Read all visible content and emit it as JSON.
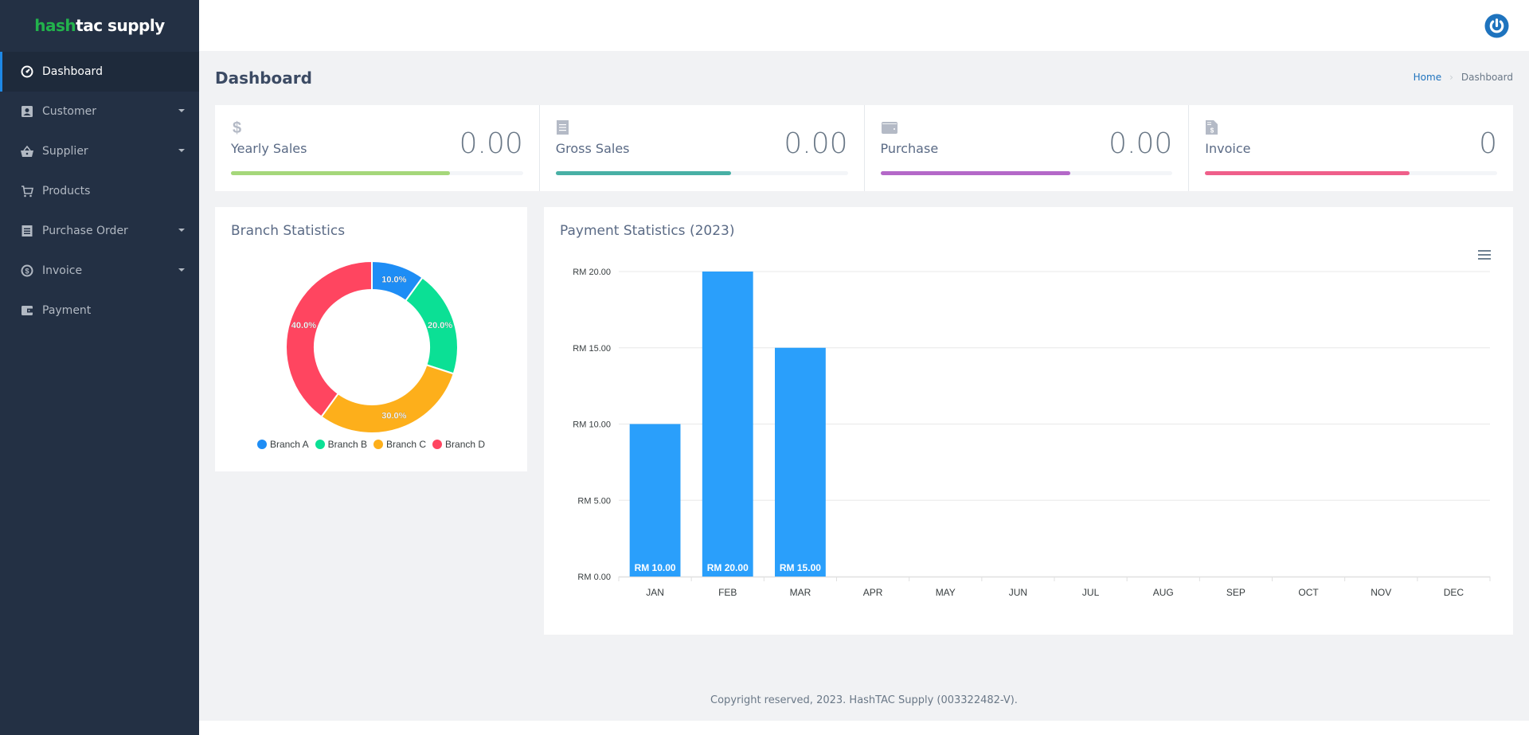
{
  "brand": {
    "part1": "hash",
    "part2": "tac supply"
  },
  "sidebar": {
    "items": [
      {
        "label": "Dashboard",
        "icon": "dashboard-icon",
        "active": true,
        "has_submenu": false
      },
      {
        "label": "Customer",
        "icon": "contact-card-icon",
        "active": false,
        "has_submenu": true
      },
      {
        "label": "Supplier",
        "icon": "basket-icon",
        "active": false,
        "has_submenu": true
      },
      {
        "label": "Products",
        "icon": "cart-icon",
        "active": false,
        "has_submenu": false
      },
      {
        "label": "Purchase Order",
        "icon": "receipt-icon",
        "active": false,
        "has_submenu": true
      },
      {
        "label": "Invoice",
        "icon": "dollar-circle-icon",
        "active": false,
        "has_submenu": true
      },
      {
        "label": "Payment",
        "icon": "wallet-icon",
        "active": false,
        "has_submenu": false
      }
    ]
  },
  "header": {
    "logout_icon": "power-icon"
  },
  "page": {
    "title": "Dashboard",
    "breadcrumb": {
      "home": "Home",
      "current": "Dashboard"
    }
  },
  "stats": [
    {
      "label": "Yearly Sales",
      "value": "0.00",
      "icon": "dollar-icon",
      "progress": 0.75,
      "color": "#a5d77a"
    },
    {
      "label": "Gross Sales",
      "value": "0.00",
      "icon": "receipt-icon",
      "progress": 0.6,
      "color": "#48b0a5"
    },
    {
      "label": "Purchase",
      "value": "0.00",
      "icon": "wallet-icon",
      "progress": 0.65,
      "color": "#b468c8"
    },
    {
      "label": "Invoice",
      "value": "0",
      "icon": "invoice-icon",
      "progress": 0.7,
      "color": "#ef5f8a"
    }
  ],
  "chart_data": [
    {
      "type": "pie",
      "title": "Branch Statistics",
      "donut": true,
      "categories": [
        "Branch A",
        "Branch B",
        "Branch C",
        "Branch D"
      ],
      "values": [
        10,
        20,
        30,
        40
      ],
      "labels": [
        "10.0%",
        "20.0%",
        "30.0%",
        "40.0%"
      ],
      "colors": [
        "#1e8df5",
        "#0be095",
        "#fdaf1b",
        "#ff4560"
      ],
      "legend": "bottom"
    },
    {
      "type": "bar",
      "title": "Payment Statistics (2023)",
      "categories": [
        "JAN",
        "FEB",
        "MAR",
        "APR",
        "MAY",
        "JUN",
        "JUL",
        "AUG",
        "SEP",
        "OCT",
        "NOV",
        "DEC"
      ],
      "values": [
        10,
        20,
        15,
        null,
        null,
        null,
        null,
        null,
        null,
        null,
        null,
        null
      ],
      "data_labels": [
        "RM 10.00",
        "RM 20.00",
        "RM 15.00"
      ],
      "yticks": [
        "RM 0.00",
        "RM 5.00",
        "RM 10.00",
        "RM 15.00",
        "RM 20.00"
      ],
      "ylim": [
        0,
        20
      ],
      "grid": true,
      "color": "#2a9ffb",
      "xlabel": "",
      "ylabel": ""
    }
  ],
  "footer": {
    "text": "Copyright reserved, 2023. HashTAC Supply (003322482-V)."
  }
}
